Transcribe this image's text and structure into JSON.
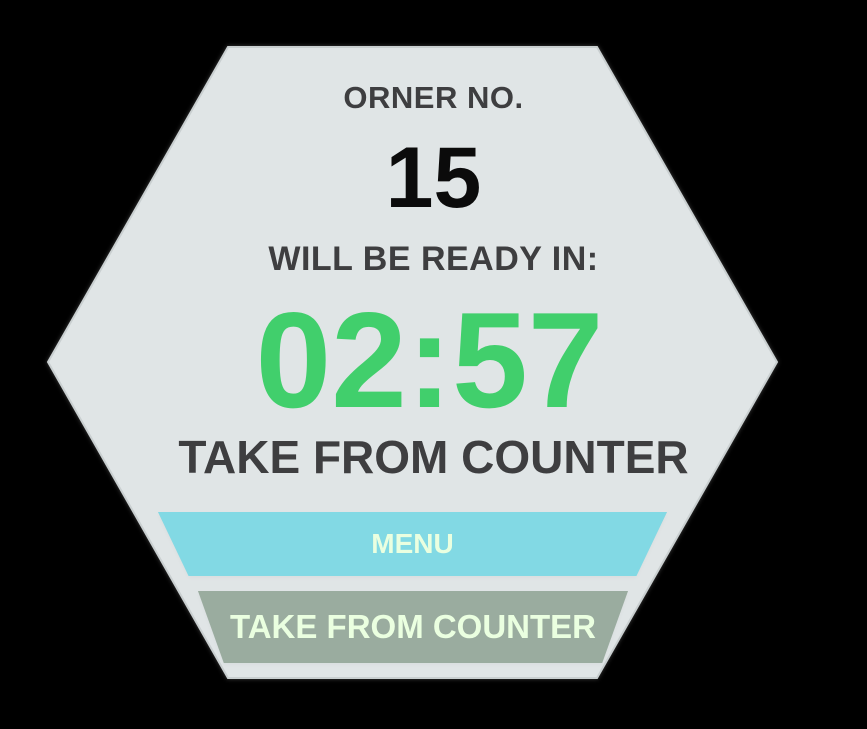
{
  "panel": {
    "order_label": "ORNER NO.",
    "order_number": "15",
    "ready_label": "WILL BE READY IN:",
    "timer": "02:57",
    "pickup_label": "TAKE FROM COUNTER"
  },
  "buttons": {
    "menu_label": "MENU",
    "take_from_counter_label": "TAKE FROM COUNTER"
  },
  "colors": {
    "background": "#000000",
    "panel": "#e0e5e6",
    "timer": "#41cf6c",
    "menu_button": "#82d9e4",
    "counter_button": "#9aac9f",
    "button_text": "#eaffe0"
  }
}
